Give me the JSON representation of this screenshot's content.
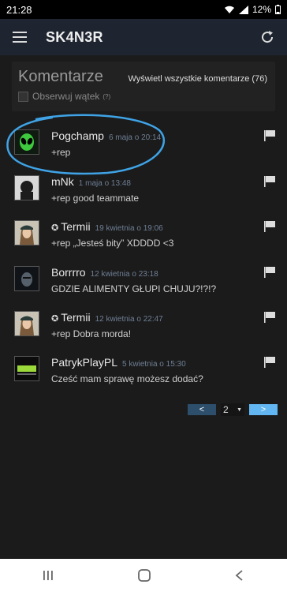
{
  "status": {
    "time": "21:28",
    "battery": "12%"
  },
  "app": {
    "title": "SK4N3R"
  },
  "comments": {
    "title": "Komentarze",
    "show_all": "Wyświetl wszystkie komentarze (76)",
    "follow_label": "Obserwuj wątek",
    "follow_help": "(?)"
  },
  "items": [
    {
      "author": "Pogchamp",
      "date": "6 maja o 20:14",
      "text": "+rep",
      "avatar": "alien-avatar",
      "badge": ""
    },
    {
      "author": "mNk",
      "date": "1 maja o 13:48",
      "text": "+rep good teammate",
      "avatar": "mnk-avatar",
      "badge": ""
    },
    {
      "author": "Termii",
      "date": "19 kwietnia o 19:06",
      "text": "+rep „Jesteś bity” XDDDD <3",
      "avatar": "girl-cap-avatar",
      "badge": "✪"
    },
    {
      "author": "Borrrro",
      "date": "12 kwietnia o 23:18",
      "text": "GDZIE ALIMENTY GŁUPI CHUJU?!?!?",
      "avatar": "dark-face-avatar",
      "badge": ""
    },
    {
      "author": "Termii",
      "date": "12 kwietnia o 22:47",
      "text": "+rep Dobra morda!",
      "avatar": "girl-cap-avatar",
      "badge": "✪"
    },
    {
      "author": "PatrykPlayPL",
      "date": "5 kwietnia o 15:30",
      "text": "Cześć mam sprawę możesz dodać?",
      "avatar": "gamer-avatar",
      "badge": ""
    }
  ],
  "pager": {
    "prev": "<",
    "page": "2",
    "next": ">"
  },
  "colors": {
    "accent": "#62b6f2",
    "annotation": "#3fa3e6"
  }
}
